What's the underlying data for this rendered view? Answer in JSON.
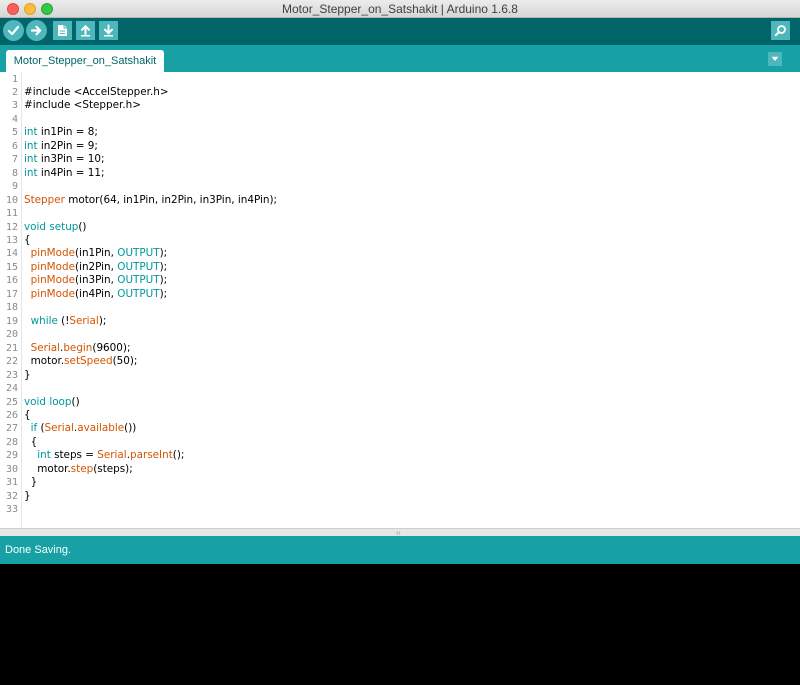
{
  "window": {
    "title": "Motor_Stepper_on_Satshakit | Arduino 1.6.8"
  },
  "toolbar": {
    "verify_icon": "checkmark-icon",
    "upload_icon": "arrow-right-icon",
    "new_icon": "document-icon",
    "open_icon": "arrow-up-icon",
    "save_icon": "arrow-down-icon",
    "serial_monitor_icon": "magnifier-icon"
  },
  "tabs": [
    {
      "label": "Motor_Stepper_on_Satshakit"
    }
  ],
  "editor": {
    "lines": [
      [],
      [
        [
          "#include <",
          ""
        ],
        [
          "AccelStepper",
          ""
        ],
        [
          ".h>",
          ""
        ]
      ],
      [
        [
          "#include <",
          ""
        ],
        [
          "Stepper",
          ""
        ],
        [
          ".h>",
          ""
        ]
      ],
      [],
      [
        [
          "int",
          "kw"
        ],
        [
          " in1Pin = 8;",
          ""
        ]
      ],
      [
        [
          "int",
          "kw"
        ],
        [
          " in2Pin = 9;",
          ""
        ]
      ],
      [
        [
          "int",
          "kw"
        ],
        [
          " in3Pin = 10;",
          ""
        ]
      ],
      [
        [
          "int",
          "kw"
        ],
        [
          " in4Pin = 11;",
          ""
        ]
      ],
      [],
      [
        [
          "Stepper",
          "fn"
        ],
        [
          " motor(64, in1Pin, in2Pin, in3Pin, in4Pin);",
          ""
        ]
      ],
      [],
      [
        [
          "void",
          "kw"
        ],
        [
          " ",
          ""
        ],
        [
          "setup",
          "kw"
        ],
        [
          "()",
          ""
        ]
      ],
      [
        [
          "{",
          ""
        ]
      ],
      [
        [
          "  ",
          ""
        ],
        [
          "pinMode",
          "fn"
        ],
        [
          "(in1Pin, ",
          ""
        ],
        [
          "OUTPUT",
          "kw"
        ],
        [
          ");",
          ""
        ]
      ],
      [
        [
          "  ",
          ""
        ],
        [
          "pinMode",
          "fn"
        ],
        [
          "(in2Pin, ",
          ""
        ],
        [
          "OUTPUT",
          "kw"
        ],
        [
          ");",
          ""
        ]
      ],
      [
        [
          "  ",
          ""
        ],
        [
          "pinMode",
          "fn"
        ],
        [
          "(in3Pin, ",
          ""
        ],
        [
          "OUTPUT",
          "kw"
        ],
        [
          ");",
          ""
        ]
      ],
      [
        [
          "  ",
          ""
        ],
        [
          "pinMode",
          "fn"
        ],
        [
          "(in4Pin, ",
          ""
        ],
        [
          "OUTPUT",
          "kw"
        ],
        [
          ");",
          ""
        ]
      ],
      [],
      [
        [
          "  ",
          ""
        ],
        [
          "while",
          "kw"
        ],
        [
          " (!",
          ""
        ],
        [
          "Serial",
          "fn"
        ],
        [
          ");",
          ""
        ]
      ],
      [],
      [
        [
          "  ",
          ""
        ],
        [
          "Serial",
          "fn"
        ],
        [
          ".",
          ""
        ],
        [
          "begin",
          "fn"
        ],
        [
          "(9600);",
          ""
        ]
      ],
      [
        [
          "  motor.",
          ""
        ],
        [
          "setSpeed",
          "fn"
        ],
        [
          "(50);",
          ""
        ]
      ],
      [
        [
          "}",
          ""
        ]
      ],
      [],
      [
        [
          "void",
          "kw"
        ],
        [
          " ",
          ""
        ],
        [
          "loop",
          "kw"
        ],
        [
          "()",
          ""
        ]
      ],
      [
        [
          "{",
          ""
        ]
      ],
      [
        [
          "  ",
          ""
        ],
        [
          "if",
          "kw"
        ],
        [
          " (",
          ""
        ],
        [
          "Serial",
          "fn"
        ],
        [
          ".",
          ""
        ],
        [
          "available",
          "fn"
        ],
        [
          "())",
          ""
        ]
      ],
      [
        [
          "  {",
          ""
        ]
      ],
      [
        [
          "    ",
          ""
        ],
        [
          "int",
          "kw"
        ],
        [
          " steps = ",
          ""
        ],
        [
          "Serial",
          "fn"
        ],
        [
          ".",
          ""
        ],
        [
          "parseInt",
          "fn"
        ],
        [
          "();",
          ""
        ]
      ],
      [
        [
          "    motor.",
          ""
        ],
        [
          "step",
          "fn"
        ],
        [
          "(steps);",
          ""
        ]
      ],
      [
        [
          "  }",
          ""
        ]
      ],
      [
        [
          "}",
          ""
        ]
      ],
      []
    ],
    "line_numbers": [
      "1",
      "2",
      "3",
      "4",
      "5",
      "6",
      "7",
      "8",
      "9",
      "10",
      "11",
      "12",
      "13",
      "14",
      "15",
      "16",
      "17",
      "18",
      "19",
      "20",
      "21",
      "22",
      "23",
      "24",
      "25",
      "26",
      "27",
      "28",
      "29",
      "30",
      "31",
      "32",
      "33"
    ]
  },
  "status": {
    "message": "Done Saving."
  },
  "colors": {
    "keyword": "#00979c",
    "function": "#d35400",
    "toolbar": "#006468",
    "tabbar": "#17a1a5"
  }
}
